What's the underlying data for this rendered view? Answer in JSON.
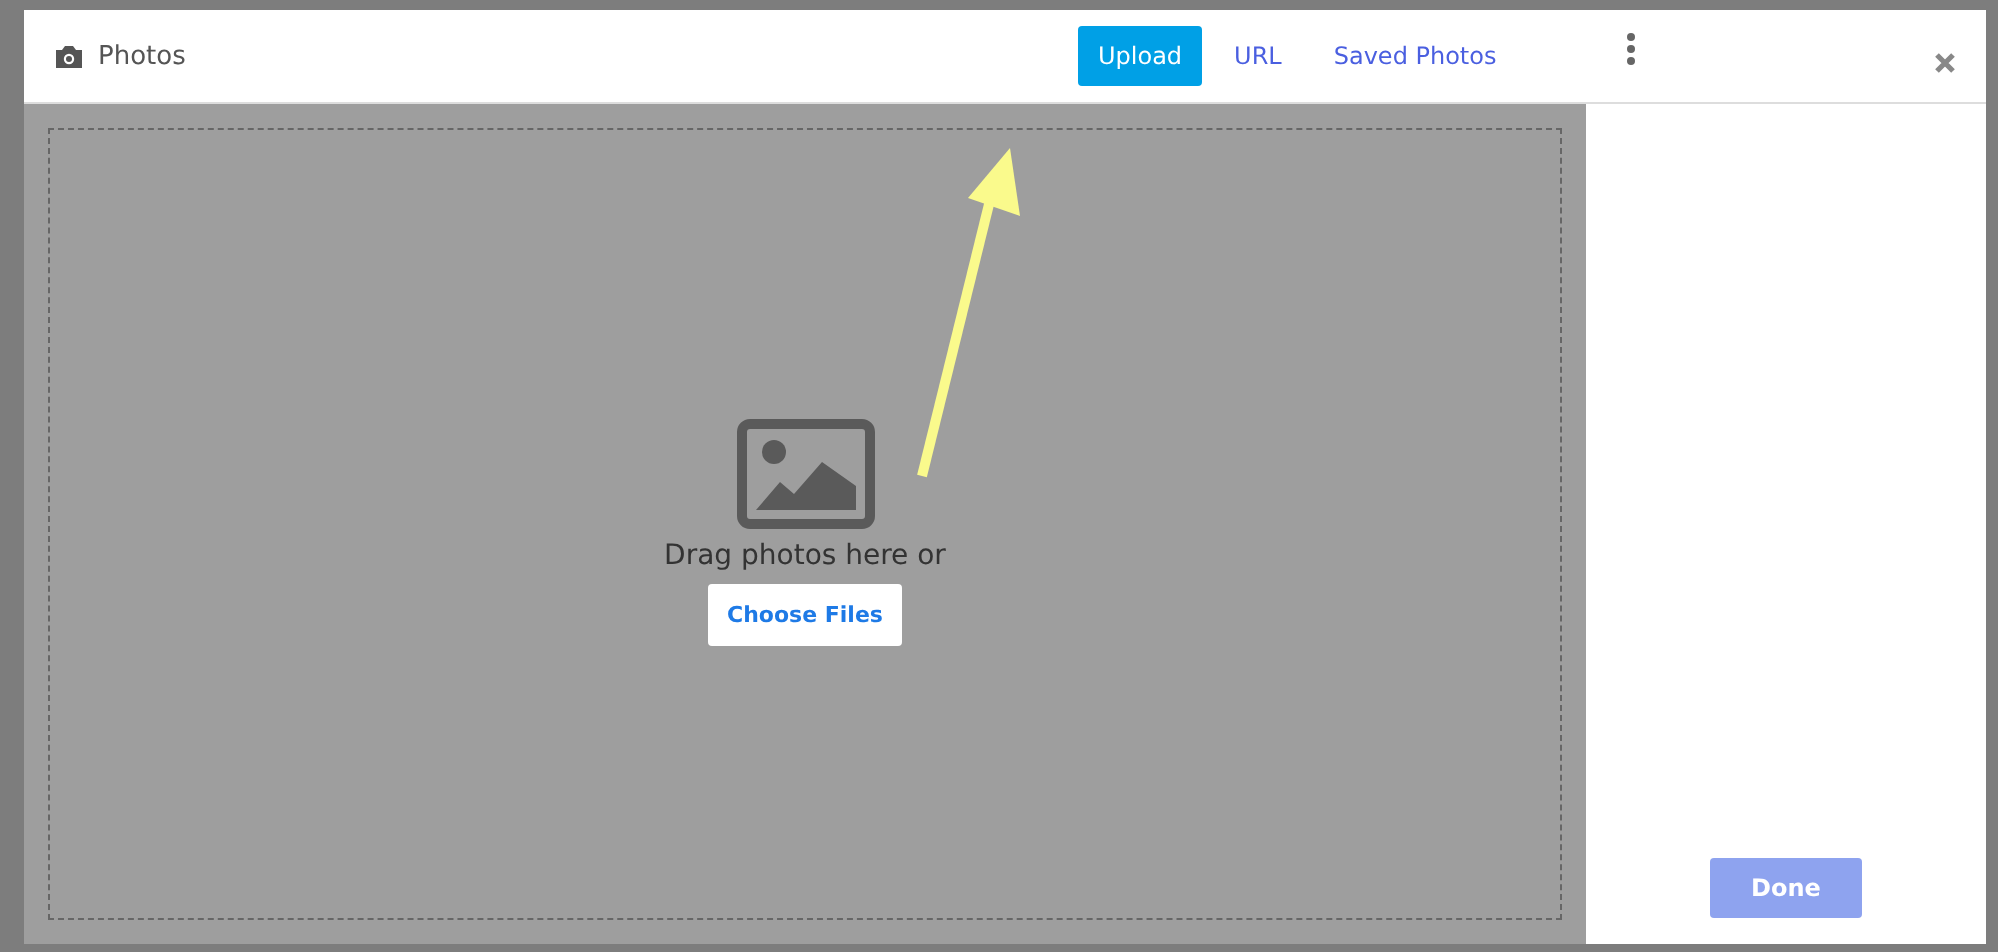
{
  "dialog": {
    "title": "Photos"
  },
  "tabs": [
    {
      "label": "Upload",
      "selected": true
    },
    {
      "label": "URL",
      "selected": false
    },
    {
      "label": "Saved Photos",
      "selected": false
    }
  ],
  "dropzone": {
    "prompt": "Drag photos here or",
    "button": "Choose Files"
  },
  "done_button": {
    "label": "Done",
    "disabled": true
  }
}
